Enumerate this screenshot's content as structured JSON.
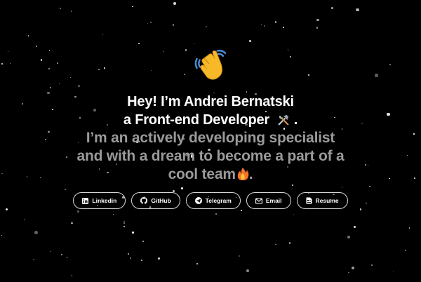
{
  "hero": {
    "wave_icon": "waving-hand-icon",
    "greeting_line1": "Hey! I’m Andrei Bernatski",
    "greeting_line2": "a Front-end Developer",
    "greeting_line2_suffix": ".",
    "tools_icon": "hammer-and-wrench-icon",
    "tagline_line1": "I’m an actively developing specialist",
    "tagline_line2": "and with a dream to become a part of a",
    "tagline_line3": "cool team",
    "tagline_line3_suffix": ".",
    "fire_icon": "fire-icon"
  },
  "links": [
    {
      "label": "Linkedin",
      "icon": "linkedin-icon"
    },
    {
      "label": "GitHub",
      "icon": "github-icon"
    },
    {
      "label": "Telegram",
      "icon": "telegram-icon"
    },
    {
      "label": "Email",
      "icon": "email-icon"
    },
    {
      "label": "Resume",
      "icon": "resume-icon"
    }
  ],
  "colors": {
    "background": "#000000",
    "heading": "#ffffff",
    "tagline": "#9a9a9a",
    "button_border": "#d8d8d8",
    "wave": "#f7b928",
    "fire": "#f5a623"
  }
}
